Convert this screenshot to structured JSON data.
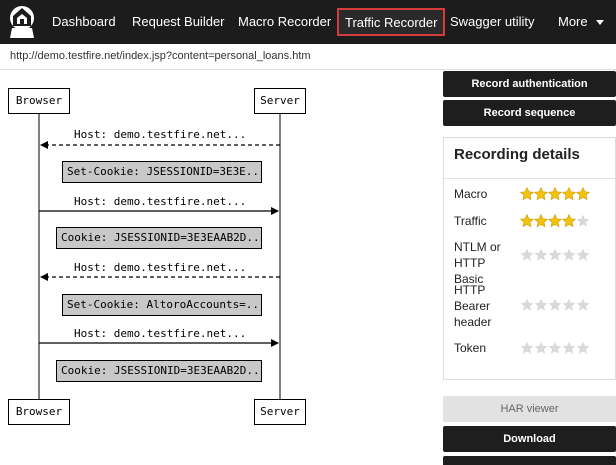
{
  "nav": {
    "logo": "logo-icon",
    "items": [
      {
        "label": "Dashboard"
      },
      {
        "label": "Request Builder"
      },
      {
        "label": "Macro Recorder"
      },
      {
        "label": "Traffic Recorder",
        "active": true
      },
      {
        "label": "Swagger utility"
      },
      {
        "label": "More"
      }
    ],
    "active_border_color": "#d43b3b"
  },
  "url": "http://demo.testfire.net/index.jsp?content=personal_loans.htm",
  "diagram": {
    "left_actor": "Browser",
    "right_actor": "Server",
    "messages": [
      {
        "label": "Host: demo.testfire.net...",
        "direction": "to-browser",
        "style": "dashed",
        "cookie": "Set-Cookie: JSESSIONID=3E3E..."
      },
      {
        "label": "Host: demo.testfire.net...",
        "direction": "to-server",
        "style": "solid",
        "cookie": "Cookie: JSESSIONID=3E3EAAB2D..."
      },
      {
        "label": "Host: demo.testfire.net...",
        "direction": "to-browser",
        "style": "dashed",
        "cookie": "Set-Cookie: AltoroAccounts=..."
      },
      {
        "label": "Host: demo.testfire.net...",
        "direction": "to-server",
        "style": "solid",
        "cookie": "Cookie: JSESSIONID=3E3EAAB2D..."
      }
    ]
  },
  "panel": {
    "record_auth": "Record authentication",
    "record_seq": "Record sequence",
    "details_title": "Recording details",
    "star_color": "#f4c20d",
    "star_empty_color": "#d9d9d9",
    "rows": [
      {
        "label": "Macro",
        "rating": 5
      },
      {
        "label": "Traffic",
        "rating": 4
      },
      {
        "label": "NTLM or HTTP Basic",
        "rating": 0
      },
      {
        "label": "HTTP Bearer header",
        "rating": 0
      },
      {
        "label": "Token",
        "rating": 0
      }
    ],
    "har_viewer": "HAR viewer",
    "download": "Download"
  }
}
